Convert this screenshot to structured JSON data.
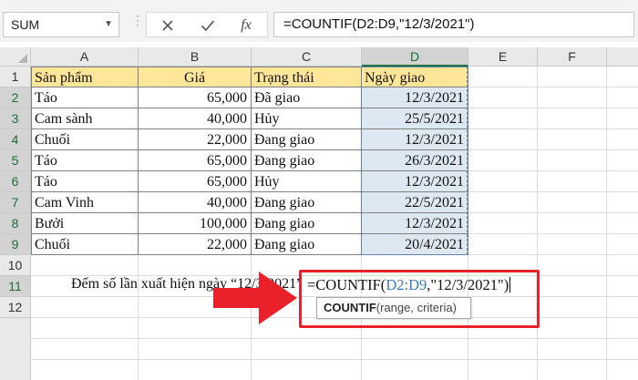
{
  "formula_bar": {
    "name_box": "SUM",
    "cancel_icon": "close-icon",
    "enter_icon": "check-icon",
    "fx_label": "fx",
    "formula": "=COUNTIF(D2:D9,\"12/3/2021\")"
  },
  "columns": [
    "A",
    "B",
    "C",
    "D",
    "E",
    "F"
  ],
  "rows": [
    "1",
    "2",
    "3",
    "4",
    "5",
    "6",
    "7",
    "8",
    "9",
    "10",
    "11",
    "12"
  ],
  "table": {
    "headers": [
      "Sản phẩm",
      "Giá",
      "Trạng thái",
      "Ngày giao"
    ],
    "rows": [
      [
        "Táo",
        "65,000",
        "Đã giao",
        "12/3/2021"
      ],
      [
        "Cam sành",
        "40,000",
        "Hủy",
        "25/5/2021"
      ],
      [
        "Chuối",
        "22,000",
        "Đang giao",
        "12/3/2021"
      ],
      [
        "Táo",
        "65,000",
        "Đang giao",
        "26/3/2021"
      ],
      [
        "Táo",
        "65,000",
        "Hủy",
        "12/3/2021"
      ],
      [
        "Cam Vinh",
        "40,000",
        "Đang giao",
        "22/5/2021"
      ],
      [
        "Bưởi",
        "100,000",
        "Đang giao",
        "12/3/2021"
      ],
      [
        "Chuối",
        "22,000",
        "Đang giao",
        "20/4/2021"
      ]
    ]
  },
  "row11": {
    "label": "Đếm số lần xuất hiện ngày “12/3/2021”",
    "formula_prefix": "=COUNTIF(",
    "formula_ref": "D2:D9",
    "formula_suffix": ",\"12/3/2021\")"
  },
  "tooltip": {
    "func": "COUNTIF",
    "args": "(range, criteria)"
  },
  "colors": {
    "header_fill": "#ffe699",
    "selected_range_fill": "#dde8f3",
    "reference_blue": "#3c7cbd",
    "highlight_red": "#e8212b",
    "excel_green": "#217346"
  }
}
